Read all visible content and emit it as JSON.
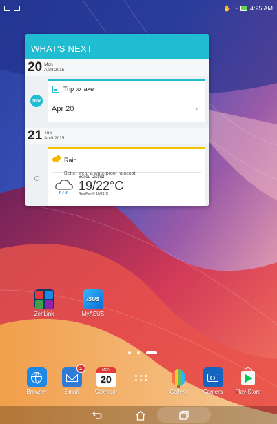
{
  "status_bar": {
    "left_icons": [
      "notification-icon",
      "gallery-notification-icon"
    ],
    "right_icons": [
      "cleaner-icon",
      "wifi-icon",
      "battery-icon"
    ],
    "time": "4:25 AM"
  },
  "widget": {
    "title": "WHAT'S NEXT",
    "days": [
      {
        "day_num": "20",
        "weekday": "Mon",
        "month_year": "April 2015",
        "marker": "Now",
        "event": {
          "icon": "calendar-event-icon",
          "title": "Trip to lake",
          "when": "Apr 20",
          "chevron": "›"
        }
      },
      {
        "day_num": "21",
        "weekday": "Tue",
        "month_year": "April 2015",
        "weather": {
          "icon": "partly-cloudy-icon",
          "title": "Rain",
          "description": "Better wear a waterproof raincoat.",
          "location": "Beitou District",
          "temperature": "19/22°C",
          "realfeel": "RealFeel® 16/21°C"
        }
      }
    ]
  },
  "desktop_apps": [
    {
      "label": "ZenLink",
      "icon": "zenlink-icon"
    },
    {
      "label": "MyASUS",
      "icon": "myasus-icon",
      "logo_text": "/SUS"
    }
  ],
  "dock_apps": [
    {
      "label": "Browser",
      "icon": "browser-globe-icon"
    },
    {
      "label": "Email",
      "icon": "email-icon",
      "badge": "1"
    },
    {
      "label": "Calendar",
      "icon": "calendar-icon",
      "month": "MON",
      "day": "20"
    },
    {
      "label": "",
      "icon": "all-apps-grid-icon"
    },
    {
      "label": "Gallery",
      "icon": "gallery-balloon-icon"
    },
    {
      "label": "Camera",
      "icon": "camera-icon"
    },
    {
      "label": "Play Store",
      "icon": "play-store-icon"
    }
  ],
  "page_indicator": {
    "pages": 3,
    "current": 3
  },
  "nav_bar": {
    "back_icon": "back-icon",
    "home_icon": "home-icon",
    "recents_icon": "recents-icon"
  },
  "colors": {
    "accent": "#1fbcd2",
    "weather_accent": "#f5c400",
    "badge": "#e53935"
  }
}
